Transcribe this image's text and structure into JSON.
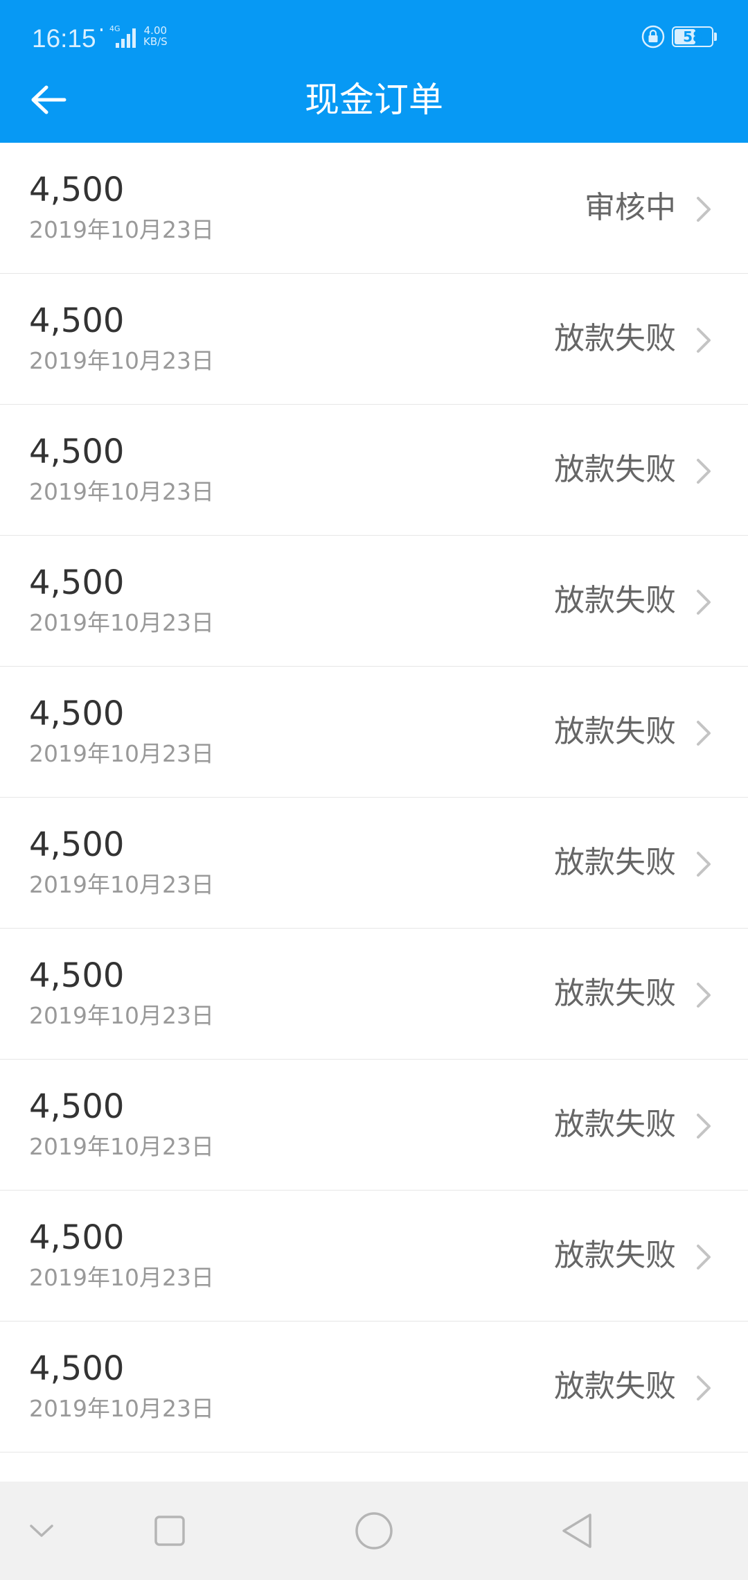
{
  "status_bar": {
    "time": "16:15",
    "network": "4G",
    "speed_value": "4.00",
    "speed_unit": "KB/S",
    "battery": "58",
    "battery_level": 0.58
  },
  "header": {
    "title": "现金订单",
    "back_icon": "arrow-left-icon",
    "background_color": "#0799f4"
  },
  "orders": [
    {
      "amount": "4,500",
      "date": "2019年10月23日",
      "status": "审核中"
    },
    {
      "amount": "4,500",
      "date": "2019年10月23日",
      "status": "放款失败"
    },
    {
      "amount": "4,500",
      "date": "2019年10月23日",
      "status": "放款失败"
    },
    {
      "amount": "4,500",
      "date": "2019年10月23日",
      "status": "放款失败"
    },
    {
      "amount": "4,500",
      "date": "2019年10月23日",
      "status": "放款失败"
    },
    {
      "amount": "4,500",
      "date": "2019年10月23日",
      "status": "放款失败"
    },
    {
      "amount": "4,500",
      "date": "2019年10月23日",
      "status": "放款失败"
    },
    {
      "amount": "4,500",
      "date": "2019年10月23日",
      "status": "放款失败"
    },
    {
      "amount": "4,500",
      "date": "2019年10月23日",
      "status": "放款失败"
    },
    {
      "amount": "4,500",
      "date": "2019年10月23日",
      "status": "放款失败"
    }
  ],
  "nav_bar": {
    "icons": [
      "chevron-down-icon",
      "square-icon",
      "circle-icon",
      "triangle-back-icon"
    ]
  }
}
